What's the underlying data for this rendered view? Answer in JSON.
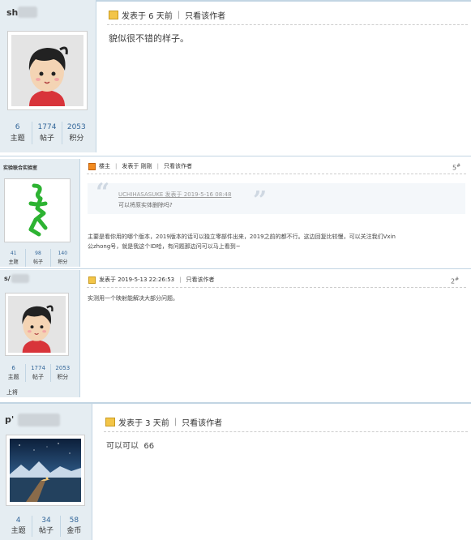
{
  "posts": [
    {
      "username": "sh",
      "stats": [
        {
          "value": "6",
          "label": "主题"
        },
        {
          "value": "1774",
          "label": "帖子"
        },
        {
          "value": "2053",
          "label": "积分"
        }
      ],
      "posted": "发表于 6 天前",
      "view_author": "只看该作者",
      "content": "貌似很不错的样子。"
    },
    {
      "username": "实验联合实验室",
      "stats": [
        {
          "value": "41",
          "label": "主题"
        },
        {
          "value": "98",
          "label": "帖子"
        },
        {
          "value": "140",
          "label": "积分"
        }
      ],
      "op_label": "楼主",
      "posted": "发表于 刚刚",
      "view_author": "只看该作者",
      "floor": "5",
      "floor_sup": "#",
      "quote_author": "UCHIHASASUKE 发表于 2019-5-16 08:48",
      "quote_text": "可以将原实体删除吗?",
      "content_line1": "主要是看你用的哪个版本，2019版本的话可以独立零部件出来，2019之前的都不行。这边回复比较慢，可以关注我们Vxin",
      "content_line2": "公zhong号，就是我这个ID哈，有问题那边问可以马上看到~"
    },
    {
      "username": "s/",
      "stats": [
        {
          "value": "6",
          "label": "主题"
        },
        {
          "value": "1774",
          "label": "帖子"
        },
        {
          "value": "2053",
          "label": "积分"
        }
      ],
      "footer": "上将",
      "posted": "发表于 2019-5-13 22:26:53",
      "view_author": "只看该作者",
      "floor": "2",
      "floor_sup": "#",
      "content": "实测用一个映射能解决大部分问题。"
    },
    {
      "username": "p'",
      "stats": [
        {
          "value": "4",
          "label": "主题"
        },
        {
          "value": "34",
          "label": "帖子"
        },
        {
          "value": "58",
          "label": "金币"
        }
      ],
      "posted": "发表于 3 天前",
      "view_author": "只看该作者",
      "content": "可以可以  66"
    }
  ]
}
